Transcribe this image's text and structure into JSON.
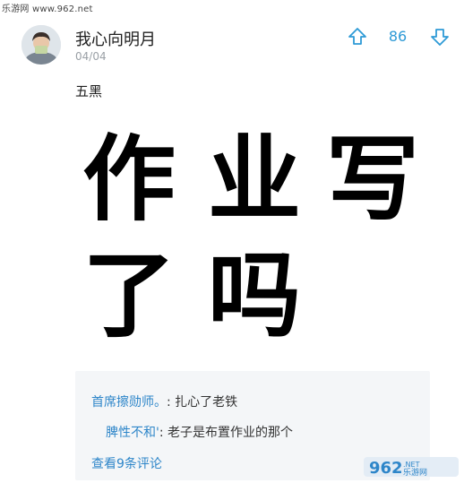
{
  "watermark": {
    "top_left": "乐游网 www.962.net",
    "logo_text": "962",
    "logo_suffix": ".NET",
    "logo_cn": "乐游网"
  },
  "post": {
    "username": "我心向明月",
    "date": "04/04",
    "upvotes": "86",
    "text": "五黑",
    "meme_glyphs": [
      "作",
      "业",
      "写",
      "了",
      "吗"
    ]
  },
  "comments": [
    {
      "author": "首席擦勋师。",
      "separator": ":",
      "text": "扎心了老铁"
    },
    {
      "author": "脾性不和'",
      "separator": ":",
      "text": "老子是布置作业的那个"
    }
  ],
  "view_all": "查看9条评论",
  "colors": {
    "accent": "#2e9ad6",
    "link": "#2e86c9",
    "comment_bg": "#f4f6f8",
    "meta": "#9aa0a6"
  },
  "icons": {
    "upvote": "arrow-up-outline-icon",
    "downvote": "arrow-down-outline-icon"
  }
}
